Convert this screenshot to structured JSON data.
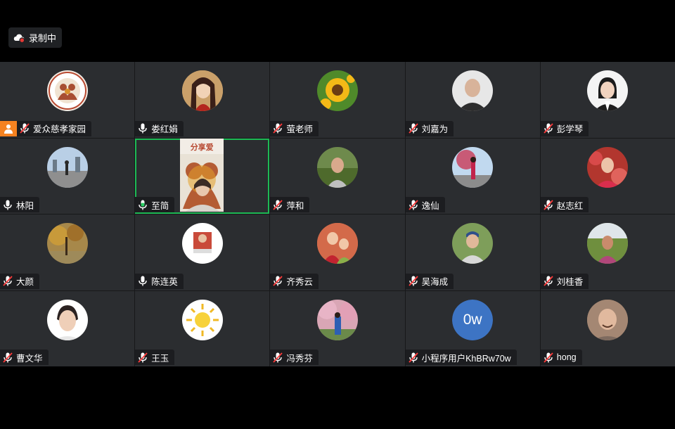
{
  "recording": {
    "label": "录制中",
    "icon": "cloud-record-icon",
    "dot_color": "#e53935"
  },
  "colors": {
    "active_border": "#1db954",
    "host_badge": "#f58220",
    "tile_bg": "#2b2d30"
  },
  "participants": [
    {
      "name": "爱众慈孝家园",
      "mic": "muted",
      "host": true,
      "avatar": "logo",
      "bg": "#f3ece4"
    },
    {
      "name": "娄红娟",
      "mic": "on",
      "avatar": "portrait",
      "bg": "#d9b06a"
    },
    {
      "name": "萤老师",
      "mic": "muted",
      "avatar": "sunflower",
      "bg": "#4f8a2a"
    },
    {
      "name": "刘嘉为",
      "mic": "muted",
      "avatar": "man",
      "bg": "#e7e7e7"
    },
    {
      "name": "彭学琴",
      "mic": "muted",
      "avatar": "woman",
      "bg": "#f4f4f4"
    },
    {
      "name": "林阳",
      "mic": "on",
      "avatar": "city",
      "bg": "#b9cfe6"
    },
    {
      "name": "至简",
      "mic": "speaking",
      "avatar": "video",
      "active": true,
      "video_label": "分享爱"
    },
    {
      "name": "萍和",
      "mic": "muted",
      "avatar": "garden",
      "bg": "#6e8a4c"
    },
    {
      "name": "逸仙",
      "mic": "muted",
      "avatar": "tree",
      "bg": "#c1d9ef"
    },
    {
      "name": "赵志红",
      "mic": "muted",
      "avatar": "flowers",
      "bg": "#b2362e"
    },
    {
      "name": "大颜",
      "mic": "muted",
      "avatar": "autumn",
      "bg": "#a7884a"
    },
    {
      "name": "陈连英",
      "mic": "on",
      "avatar": "photo-small",
      "bg": "#ffffff"
    },
    {
      "name": "齐秀云",
      "mic": "muted",
      "avatar": "kids",
      "bg": "#d37a4f"
    },
    {
      "name": "吴海成",
      "mic": "muted",
      "avatar": "man-cap",
      "bg": "#7e9e5a"
    },
    {
      "name": "刘桂香",
      "mic": "muted",
      "avatar": "field",
      "bg": "#9fb27a"
    },
    {
      "name": "曹文华",
      "mic": "muted",
      "avatar": "woman2",
      "bg": "#ffffff"
    },
    {
      "name": "王玉",
      "mic": "muted",
      "avatar": "sun",
      "bg": "#ffffff"
    },
    {
      "name": "冯秀芬",
      "mic": "muted",
      "avatar": "blossom",
      "bg": "#d9a6b5"
    },
    {
      "name": "小程序用户KhBRw70w",
      "mic": "muted",
      "avatar": "initials",
      "initials": "0w",
      "bg": "#3d74c4"
    },
    {
      "name": "hong",
      "mic": "muted",
      "avatar": "man2",
      "bg": "#8a6b55"
    }
  ]
}
